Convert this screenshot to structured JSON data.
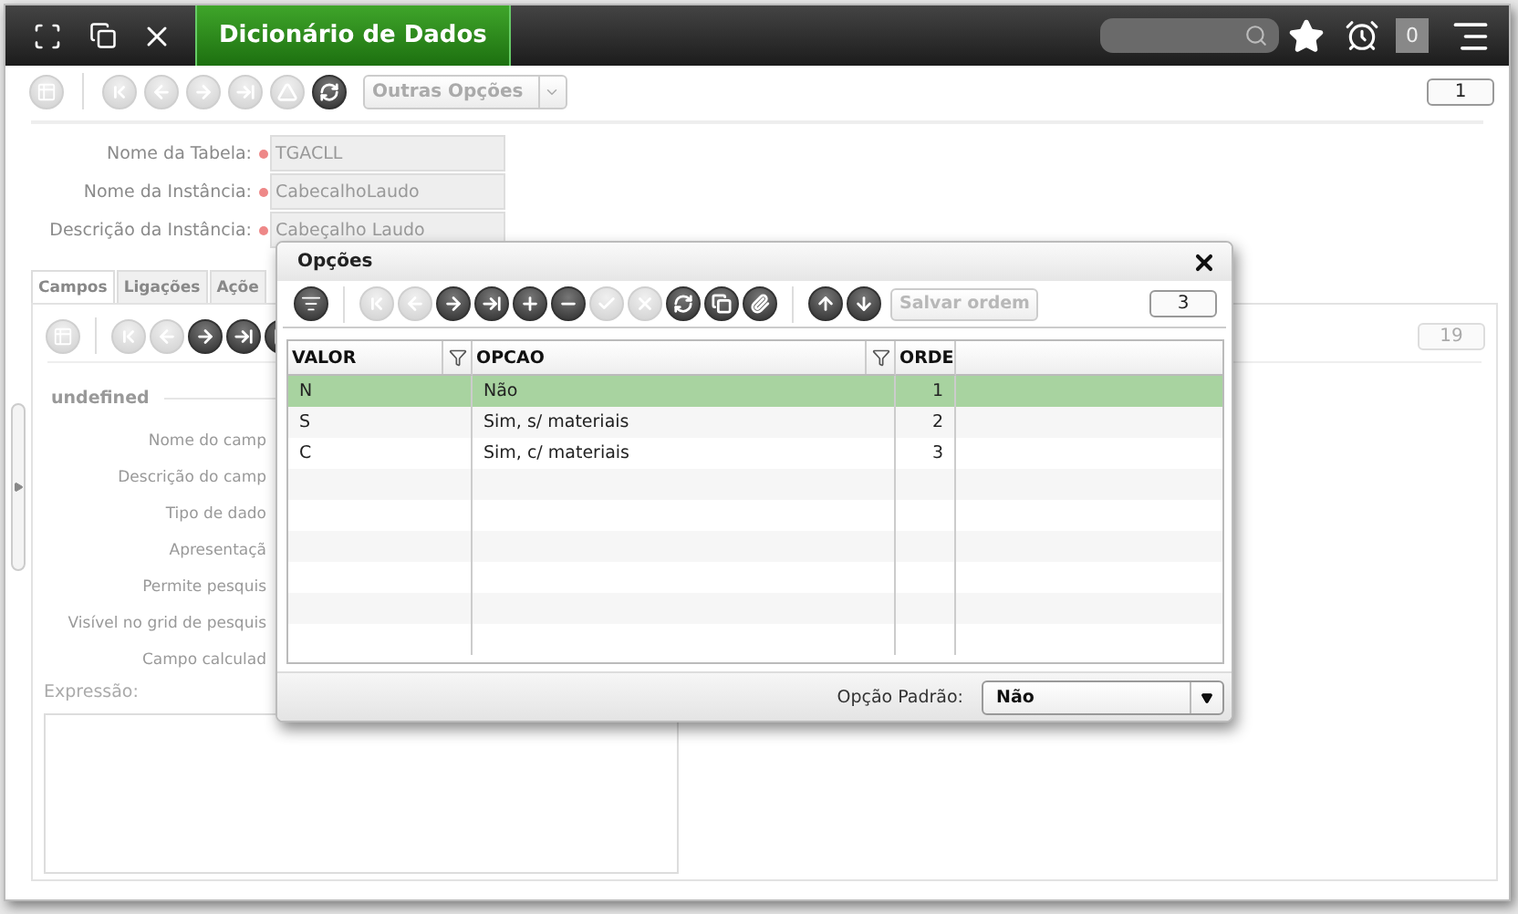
{
  "header": {
    "tab": "Dicionário de Dados",
    "badge": "0"
  },
  "toolbar": {
    "buttons": [
      {
        "disabled": true
      },
      {
        "disabled": true
      },
      {
        "disabled": true
      },
      {
        "disabled": true
      },
      {
        "disabled": true
      },
      {
        "disabled": false
      }
    ],
    "dropdown": "Outras Opções",
    "counter": "1"
  },
  "form": [
    {
      "label": "Nome da Tabela:",
      "value": "TGACLL"
    },
    {
      "label": "Nome da Instância:",
      "value": "CabecalhoLaudo"
    },
    {
      "label": "Descrição da Instância:",
      "value": "Cabeçalho Laudo"
    }
  ],
  "tabs": [
    {
      "label": "Campos",
      "selected": true
    },
    {
      "label": "Ligações",
      "selected": false
    },
    {
      "label": "Açõe",
      "selected": false
    }
  ],
  "panel": {
    "buttons": [
      {
        "disabled": true
      },
      {
        "disabled": true
      },
      {
        "disabled": false
      },
      {
        "disabled": false
      },
      {
        "disabled": false
      }
    ],
    "counter": "19",
    "legend": "undefined",
    "labels": [
      "Nome do camp",
      "Descrição do camp",
      "Tipo de dado",
      "Apresentaçã",
      "Permite pesquis",
      "Visível no grid de pesquis",
      "Campo calculad"
    ],
    "expression_label": "Expressão:"
  },
  "dialog": {
    "title": "Opções",
    "buttons": [
      {
        "disabled": true
      },
      {
        "disabled": true
      },
      {
        "disabled": false
      },
      {
        "disabled": false
      },
      {
        "disabled": false
      },
      {
        "disabled": false
      },
      {
        "disabled": true
      },
      {
        "disabled": true
      },
      {
        "disabled": false
      },
      {
        "disabled": false
      },
      {
        "disabled": false
      }
    ],
    "order_buttons": [
      {
        "disabled": false
      },
      {
        "disabled": false
      }
    ],
    "save_order": {
      "label": "Salvar ordem",
      "disabled": true
    },
    "counter": "3",
    "columns": [
      {
        "label": "VALOR",
        "filter": true
      },
      {
        "label": "OPCAO",
        "filter": true
      },
      {
        "label": "ORDE"
      }
    ],
    "rows": [
      {
        "valor": "N",
        "opcao": "Não",
        "ordem": "1",
        "selected": true
      },
      {
        "valor": "S",
        "opcao": "Sim, s/ materiais",
        "ordem": "2",
        "selected": false
      },
      {
        "valor": "C",
        "opcao": "Sim, c/ materiais",
        "ordem": "3",
        "selected": false
      }
    ],
    "default_label": "Opção Padrão:",
    "default_value": "Não"
  }
}
